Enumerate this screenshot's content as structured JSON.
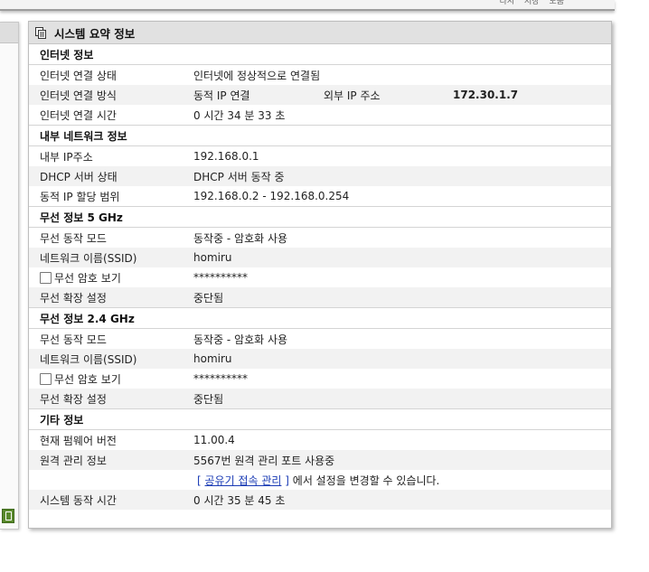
{
  "top_links": [
    "다시",
    "저장",
    "도움"
  ],
  "panel": {
    "title": "시스템 요약 정보",
    "title_icon": "document-copy-icon"
  },
  "internet": {
    "heading": "인터넷 정보",
    "status_label": "인터넷 연결 상태",
    "status_value": "인터넷에 정상적으로 연결됨",
    "method_label": "인터넷 연결 방식",
    "method_value": "동적 IP 연결",
    "external_ip_label": "외부 IP 주소",
    "external_ip_value": "172.30.1.7",
    "time_label": "인터넷 연결 시간",
    "time_value": "0 시간 34 분 33 초"
  },
  "lan": {
    "heading": "내부 네트워크 정보",
    "ip_label": "내부 IP주소",
    "ip_value": "192.168.0.1",
    "dhcp_label": "DHCP 서버 상태",
    "dhcp_value": "DHCP 서버 동작 중",
    "range_label": "동적 IP 할당 범위",
    "range_value": "192.168.0.2 -  192.168.0.254"
  },
  "wifi5": {
    "heading": "무선 정보 5 GHz",
    "mode_label": "무선 동작 모드",
    "mode_value": "동작중 - 암호화 사용",
    "ssid_label": "네트워크 이름(SSID)",
    "ssid_value": "homiru",
    "show_pw_label": "무선 암호 보기",
    "pw_value": "**********",
    "ext_label": "무선 확장 설정",
    "ext_value": "중단됨"
  },
  "wifi24": {
    "heading": "무선 정보 2.4 GHz",
    "mode_label": "무선 동작 모드",
    "mode_value": "동작중 - 암호화 사용",
    "ssid_label": "네트워크 이름(SSID)",
    "ssid_value": "homiru",
    "show_pw_label": "무선 암호 보기",
    "pw_value": "**********",
    "ext_label": "무선 확장 설정",
    "ext_value": "중단됨"
  },
  "other": {
    "heading": "기타 정보",
    "fw_label": "현재 펌웨어 버전",
    "fw_value": "11.00.4",
    "remote_label": "원격 관리 정보",
    "remote_value": "5567번 원격 관리 포트 사용중",
    "link_open": "[",
    "link_text": "공유기 접속 관리",
    "link_close": "]",
    "link_suffix": "에서 설정을 변경할 수 있습니다.",
    "uptime_label": "시스템 동작 시간",
    "uptime_value": "0 시간 35 분 45 초"
  }
}
